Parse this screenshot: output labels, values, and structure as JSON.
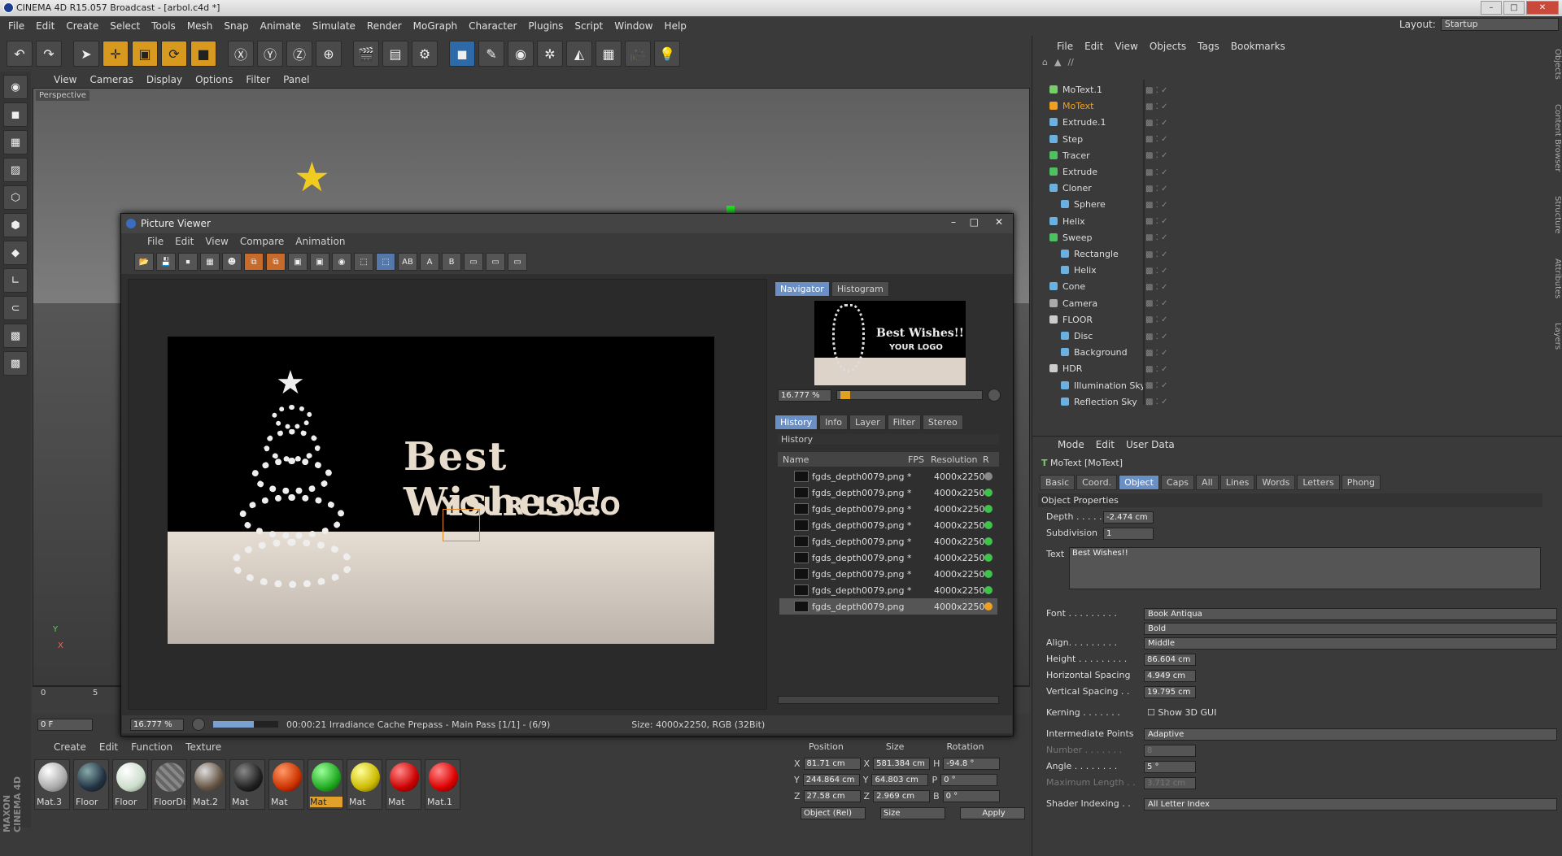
{
  "app": {
    "title": "CINEMA 4D R15.057 Broadcast - [arbol.c4d *]",
    "layout_label": "Layout:",
    "layout_value": "Startup"
  },
  "menu": [
    "File",
    "Edit",
    "Create",
    "Select",
    "Tools",
    "Mesh",
    "Snap",
    "Animate",
    "Simulate",
    "Render",
    "MoGraph",
    "Character",
    "Plugins",
    "Script",
    "Window",
    "Help"
  ],
  "viewport": {
    "menu": [
      "View",
      "Cameras",
      "Display",
      "Options",
      "Filter",
      "Panel"
    ],
    "label": "Perspective",
    "axis_x": "X",
    "axis_y": "Y",
    "axis_z": "Z",
    "ruler": [
      "0",
      "5"
    ]
  },
  "timeline": {
    "frame": "0 F",
    "zoom": "16.777 %"
  },
  "picture_viewer": {
    "title": "Picture Viewer",
    "menu": [
      "File",
      "Edit",
      "View",
      "Compare",
      "Animation"
    ],
    "render_text1": "Best Wishes!!",
    "render_text2": "YOUR LOGO",
    "nav_tabs": [
      "Navigator",
      "Histogram"
    ],
    "nav_zoom": "16.777 %",
    "tabs": [
      "History",
      "Info",
      "Layer",
      "Filter",
      "Stereo"
    ],
    "history_label": "History",
    "cols": {
      "name": "Name",
      "fps": "FPS",
      "res": "Resolution",
      "r": "R"
    },
    "rows": [
      {
        "name": "fgds_depth0079.png *",
        "res": "4000x2250",
        "color": "#888888"
      },
      {
        "name": "fgds_depth0079.png *",
        "res": "4000x2250",
        "color": "#3ec24a"
      },
      {
        "name": "fgds_depth0079.png *",
        "res": "4000x2250",
        "color": "#3ec24a"
      },
      {
        "name": "fgds_depth0079.png *",
        "res": "4000x2250",
        "color": "#3ec24a"
      },
      {
        "name": "fgds_depth0079.png *",
        "res": "4000x2250",
        "color": "#3ec24a"
      },
      {
        "name": "fgds_depth0079.png *",
        "res": "4000x2250",
        "color": "#3ec24a"
      },
      {
        "name": "fgds_depth0079.png *",
        "res": "4000x2250",
        "color": "#3ec24a"
      },
      {
        "name": "fgds_depth0079.png *",
        "res": "4000x2250",
        "color": "#3ec24a"
      },
      {
        "name": "fgds_depth0079.png",
        "res": "4000x2250",
        "color": "#f0a020"
      }
    ],
    "status_zoom": "16.777 %",
    "status_time": "00:00:21 Irradiance Cache Prepass - Main Pass [1/1] - (6/9)",
    "status_size": "Size: 4000x2250, RGB (32Bit)"
  },
  "materials": {
    "menu": [
      "Create",
      "Edit",
      "Function",
      "Texture"
    ],
    "items": [
      {
        "name": "Mat.3",
        "color": "radial-gradient(circle at 35% 30%,#fff,#aaa 60%,#555)"
      },
      {
        "name": "Floor",
        "color": "radial-gradient(circle at 35% 30%,#8aa,#234 60%,#111)"
      },
      {
        "name": "Floor",
        "color": "radial-gradient(circle at 35% 30%,#fff,#cdc 60%,#676)"
      },
      {
        "name": "FloorDis",
        "color": "repeating-linear-gradient(45deg,#888 0 4px,#666 4px 8px)"
      },
      {
        "name": "Mat.2",
        "color": "radial-gradient(circle at 35% 30%,#ddd,#654 60%,#222)"
      },
      {
        "name": "Mat",
        "color": "radial-gradient(circle at 35% 30%,#888,#222 60%,#000)"
      },
      {
        "name": "Mat",
        "color": "radial-gradient(circle at 35% 30%,#f96,#c30 60%,#400)"
      },
      {
        "name": "Mat",
        "color": "radial-gradient(circle at 35% 30%,#9f9,#2a2 60%,#040)"
      },
      {
        "name": "Mat",
        "color": "radial-gradient(circle at 35% 30%,#ff9,#cb0 60%,#540)"
      },
      {
        "name": "Mat",
        "color": "radial-gradient(circle at 35% 30%,#f88,#c00 60%,#400)"
      },
      {
        "name": "Mat.1",
        "color": "radial-gradient(circle at 35% 30%,#f88,#d00 60%,#400)"
      }
    ]
  },
  "coords": {
    "headers": [
      "Position",
      "Size",
      "Rotation"
    ],
    "rows": [
      {
        "a": "X",
        "pos": "81.71 cm",
        "b": "X",
        "size": "581.384 cm",
        "c": "H",
        "rot": "-94.8 °"
      },
      {
        "a": "Y",
        "pos": "244.864 cm",
        "b": "Y",
        "size": "64.803 cm",
        "c": "P",
        "rot": "0 °"
      },
      {
        "a": "Z",
        "pos": "27.58 cm",
        "b": "Z",
        "size": "2.969 cm",
        "c": "B",
        "rot": "0 °"
      }
    ],
    "mode": "Object (Rel)",
    "sizemode": "Size",
    "apply": "Apply"
  },
  "objects": {
    "menu": [
      "File",
      "Edit",
      "View",
      "Objects",
      "Tags",
      "Bookmarks"
    ],
    "path": "//",
    "items": [
      {
        "name": "MoText.1",
        "color": "#7acb6a"
      },
      {
        "name": "MoText",
        "color": "#f0a020"
      },
      {
        "name": "Extrude.1",
        "color": "#6ab0e0"
      },
      {
        "name": "Step",
        "color": "#6ab0e0"
      },
      {
        "name": "Tracer",
        "color": "#4fc060"
      },
      {
        "name": "Extrude",
        "color": "#4fc060"
      },
      {
        "name": "Cloner",
        "color": "#6ab0e0"
      },
      {
        "name": "Sphere",
        "color": "#6ab0e0"
      },
      {
        "name": "Helix",
        "color": "#6ab0e0"
      },
      {
        "name": "Sweep",
        "color": "#4fc060"
      },
      {
        "name": "Rectangle",
        "color": "#6ab0e0"
      },
      {
        "name": "Helix",
        "color": "#6ab0e0"
      },
      {
        "name": "Cone",
        "color": "#6ab0e0"
      },
      {
        "name": "Camera",
        "color": "#aaaaaa"
      },
      {
        "name": "FLOOR",
        "color": "#cccccc"
      },
      {
        "name": "Disc",
        "color": "#6ab0e0"
      },
      {
        "name": "Background",
        "color": "#6ab0e0"
      },
      {
        "name": "HDR",
        "color": "#cccccc"
      },
      {
        "name": "Illumination Sky",
        "color": "#6ab0e0"
      },
      {
        "name": "Reflection Sky",
        "color": "#6ab0e0"
      }
    ]
  },
  "attributes": {
    "menu": [
      "Mode",
      "Edit",
      "User Data"
    ],
    "object": "MoText [MoText]",
    "tabs": [
      "Basic",
      "Coord.",
      "Object",
      "Caps",
      "All",
      "Lines",
      "Words",
      "Letters",
      "Phong"
    ],
    "section": "Object Properties",
    "depth_label": "Depth . . . . .",
    "depth": "-2.474 cm",
    "subdiv_label": "Subdivision",
    "subdiv": "1",
    "text_label": "Text",
    "text": "Best Wishes!!",
    "font_label": "Font . . . . . . . . .",
    "font": "Book Antiqua",
    "font_style": "Bold",
    "align_label": "Align. . . . . . . . .",
    "align": "Middle",
    "height_label": "Height . . . . . . . . .",
    "height": "86.604 cm",
    "hspace_label": "Horizontal Spacing",
    "hspace": "4.949 cm",
    "vspace_label": "Vertical Spacing . .",
    "vspace": "19.795 cm",
    "kerning_label": "Kerning . . . . . . .",
    "show3d": "Show 3D GUI",
    "ip_label": "Intermediate Points",
    "ip": "Adaptive",
    "number_label": "Number . . . . . . .",
    "number": "8",
    "angle_label": "Angle . . . . . . . .",
    "angle": "5 °",
    "maxlen_label": "Maximum Length . .",
    "maxlen": "3.712 cm",
    "shader_label": "Shader Indexing . .",
    "shader": "All Letter Index"
  },
  "side_tabs": [
    "Objects",
    "Content Browser",
    "Structure",
    "Attributes",
    "Layers"
  ]
}
